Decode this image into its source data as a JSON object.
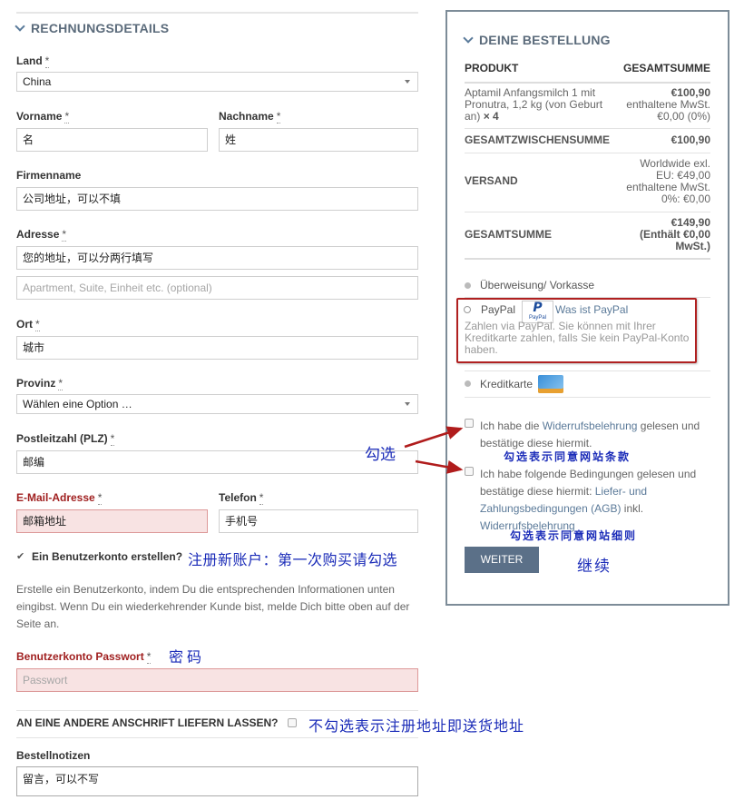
{
  "billing": {
    "title": "RECHNUNGSDETAILS",
    "country_label": "Land",
    "country_value": "China",
    "firstname_label": "Vorname",
    "firstname_value": "名",
    "lastname_label": "Nachname",
    "lastname_value": "姓",
    "company_label": "Firmenname",
    "company_value": "公司地址，可以不填",
    "address_label": "Adresse",
    "address_value": "您的地址，可以分两行填写",
    "address2_placeholder": "Apartment, Suite, Einheit etc. (optional)",
    "city_label": "Ort",
    "city_value": "城市",
    "state_label": "Provinz",
    "state_value": "Wählen eine Option …",
    "zip_label": "Postleitzahl (PLZ)",
    "zip_value": "邮编",
    "email_label": "E-Mail-Adresse",
    "email_value": "邮箱地址",
    "phone_label": "Telefon",
    "phone_value": "手机号",
    "required_mark": "*",
    "create_account_label": "Ein Benutzerkonto erstellen?",
    "create_account_desc": "Erstelle ein Benutzerkonto, indem Du die entsprechenden Informationen unten eingibst. Wenn Du ein wiederkehrender Kunde bist, melde Dich bitte oben auf der Seite an.",
    "password_label": "Benutzerkonto Passwort",
    "password_placeholder": "Passwort",
    "ship_diff_label": "AN EINE ANDERE ANSCHRIFT LIEFERN LASSEN?",
    "notes_label": "Bestellnotizen",
    "notes_value": "留言，可以不写"
  },
  "order": {
    "title": "DEINE BESTELLUNG",
    "col_product": "PRODUKT",
    "col_total": "GESAMTSUMME",
    "item_line1": "Aptamil Anfangsmilch 1 mit",
    "item_line2": "Pronutra, 1,2 kg (von Geburt",
    "item_line3": "an)",
    "item_qty": "× 4",
    "item_price": "€100,90",
    "item_tax_line1": "enthaltene MwSt.",
    "item_tax_line2": "€0,00 (0%)",
    "subtotal_label": "GESAMTZWISCHENSUMME",
    "subtotal_value": "€100,90",
    "shipping_label": "VERSAND",
    "shipping_line1": "Worldwide exl.",
    "shipping_line2": "EU: €49,00",
    "shipping_line3": "enthaltene MwSt.",
    "shipping_line4": "0%: €0,00",
    "total_label": "GESAMTSUMME",
    "total_value": "€149,90",
    "total_tax_line1": "(Enthält €0,00",
    "total_tax_line2": "MwSt.)"
  },
  "payment": {
    "bank": "Überweisung/ Vorkasse",
    "paypal": "PayPal",
    "paypal_badge": "PayPal",
    "paypal_link": "Was ist PayPal",
    "paypal_desc_line1": "Zahlen via PayPal. Sie können mit Ihrer",
    "paypal_desc_line2": "Kreditkarte zahlen, falls Sie kein PayPal-Konto",
    "paypal_desc_line3": "haben.",
    "card": "Kreditkarte",
    "terms1_a": "Ich habe die ",
    "terms1_link": "Widerrufsbelehrung",
    "terms1_b": " gelesen und",
    "terms1_line2": "bestätige diese hiermit.",
    "terms2_line1": "Ich habe folgende Bedingungen gelesen und",
    "terms2_line2a": "bestätige diese hiermit: ",
    "terms2_link1": "Liefer- und",
    "terms2_link2": "Zahlungsbedingungen (AGB)",
    "terms2_line3b": " inkl.",
    "terms2_link3": "Widerrufsbelehrung",
    "continue_button": "WEITER"
  },
  "annotations": {
    "check": "勾选",
    "terms_note": "勾选表示同意网站条款",
    "details_note": "勾选表示同意网站细则",
    "continue_note": "继续",
    "register_note": "注册新账户：第一次购买请勾选",
    "password_note": "密码",
    "shipping_note": "不勾选表示注册地址即送货地址"
  },
  "colors": {
    "accent": "#5b7088",
    "annotation_blue": "#1a2bb8",
    "highlight_red": "#b02020",
    "error_bg": "#f8e3e3"
  }
}
